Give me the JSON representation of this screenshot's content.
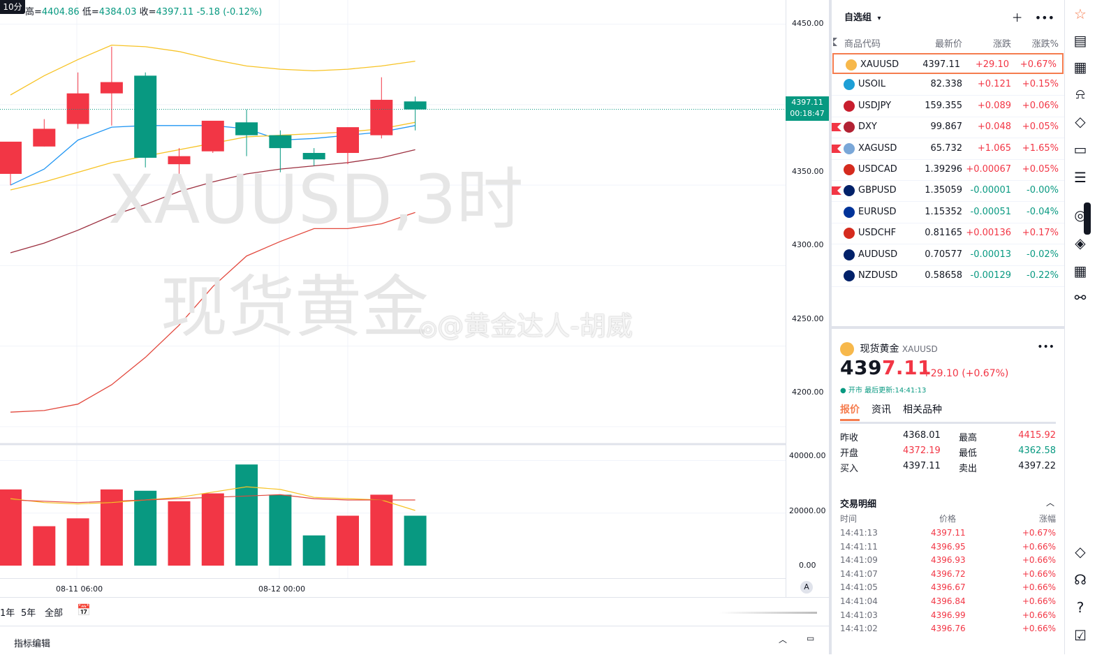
{
  "chart": {
    "interval": "10分",
    "ohlc": {
      "high_label": "高=",
      "high": "4404.86",
      "low_label": "低=",
      "low": "4384.03",
      "close_label": "收=",
      "close": "4397.11",
      "change": "-5.18",
      "change_pct": "(-0.12%)"
    },
    "watermark_symbol": "XAUUSD,3时",
    "watermark_name": "现货黄金",
    "weibo_watermark": "@黄金达人-胡威",
    "price_ticks": [
      "4450.00",
      "4400.00",
      "4350.00",
      "4300.00",
      "4250.00",
      "4200.00"
    ],
    "volume_ticks": [
      "40000.00",
      "20000.00",
      "0.00"
    ],
    "last_price": "4397.11",
    "countdown": "00:18:47",
    "time_ticks": [
      "08-11 06:00",
      "08-12 00:00"
    ],
    "range_buttons": [
      "1年",
      "5年",
      "全部"
    ],
    "auto_label": "A",
    "bottom_panel_label": "指标编辑",
    "colors": {
      "up": "#f23645",
      "down": "#089981",
      "ma_yellow": "#f7c325",
      "ma_blue": "#2196f3",
      "ma_brown": "#9c2f3f",
      "ma_red": "#e2483d"
    }
  },
  "chart_data": {
    "type": "candlestick",
    "candles": [
      {
        "open": 4357,
        "high": 4372,
        "low": 4350,
        "close": 4377
      },
      {
        "open": 4374,
        "high": 4391,
        "low": 4374,
        "close": 4385
      },
      {
        "open": 4388,
        "high": 4420,
        "low": 4385,
        "close": 4407
      },
      {
        "open": 4407,
        "high": 4436,
        "low": 4387,
        "close": 4414
      },
      {
        "open": 4418,
        "high": 4420,
        "low": 4361,
        "close": 4367
      },
      {
        "open": 4363,
        "high": 4373,
        "low": 4356,
        "close": 4368
      },
      {
        "open": 4371,
        "high": 4389,
        "low": 4370,
        "close": 4390
      },
      {
        "open": 4389,
        "high": 4397,
        "low": 4368,
        "close": 4381
      },
      {
        "open": 4381,
        "high": 4384,
        "low": 4358,
        "close": 4373
      },
      {
        "open": 4370,
        "high": 4373,
        "low": 4362,
        "close": 4366
      },
      {
        "open": 4370,
        "high": 4379,
        "low": 4363,
        "close": 4386
      },
      {
        "open": 4381,
        "high": 4417,
        "low": 4379,
        "close": 4403
      },
      {
        "open": 4402,
        "high": 4405,
        "low": 4384,
        "close": 4397
      }
    ],
    "volumes": [
      29000,
      15000,
      18000,
      29000,
      28500,
      24500,
      27500,
      38500,
      27000,
      11500,
      19000,
      27000,
      19000
    ],
    "ma_lines": [
      {
        "color": "#f7c325",
        "values": [
          4406,
          4418,
          4428,
          4437,
          4436,
          4433,
          4428,
          4424,
          4422,
          4421,
          4422,
          4424,
          4427
        ]
      },
      {
        "color": "#2196f3",
        "values": [
          4350,
          4360,
          4378,
          4386,
          4387,
          4387,
          4387,
          4385,
          4378,
          4379,
          4381,
          4383,
          4387
        ]
      },
      {
        "color": "#f7c325",
        "values": [
          4347,
          4352,
          4358,
          4364,
          4368,
          4372,
          4376,
          4380,
          4381,
          4382,
          4383,
          4385,
          4389
        ]
      },
      {
        "color": "#9c2f3f",
        "values": [
          4308,
          4314,
          4322,
          4331,
          4338,
          4346,
          4352,
          4357,
          4360,
          4362,
          4364,
          4367,
          4372
        ]
      },
      {
        "color": "#e2483d",
        "values": [
          4209,
          4210,
          4214,
          4226,
          4243,
          4263,
          4287,
          4306,
          4315,
          4323,
          4323,
          4326,
          4333
        ]
      }
    ],
    "vol_ma_lines": [
      {
        "color": "#f7c325",
        "values": [
          25500,
          24000,
          23500,
          24000,
          25000,
          26000,
          28000,
          30000,
          29000,
          26000,
          25500,
          25000,
          21000
        ]
      },
      {
        "color": "#e2483d",
        "values": [
          25000,
          24500,
          24000,
          24500,
          25000,
          25500,
          26000,
          26500,
          27000,
          25500,
          25000,
          25000,
          25000
        ]
      }
    ],
    "price_range": [
      4190,
      4465
    ],
    "volume_range": [
      0,
      42000
    ],
    "x_labels": [
      "08-11 06:00",
      "08-12 00:00"
    ]
  },
  "watchlist": {
    "title": "自选组",
    "columns": [
      "商品代码",
      "最新价",
      "涨跌",
      "涨跌%"
    ],
    "rows": [
      {
        "symbol": "XAUUSD",
        "last": "4397.11",
        "change": "+29.10",
        "pct": "+0.67%",
        "dir": "pos",
        "flag": "#f7b84b",
        "selected": true,
        "marked": false
      },
      {
        "symbol": "USOIL",
        "last": "82.338",
        "change": "+0.121",
        "pct": "+0.15%",
        "dir": "pos",
        "flag": "#1e9fd6",
        "selected": false,
        "marked": false
      },
      {
        "symbol": "USDJPY",
        "last": "159.355",
        "change": "+0.089",
        "pct": "+0.06%",
        "dir": "pos",
        "flag": "#c81e2e",
        "selected": false,
        "marked": false
      },
      {
        "symbol": "DXY",
        "last": "99.867",
        "change": "+0.048",
        "pct": "+0.05%",
        "dir": "pos",
        "flag": "#b22234",
        "selected": false,
        "marked": true
      },
      {
        "symbol": "XAGUSD",
        "last": "65.732",
        "change": "+1.065",
        "pct": "+1.65%",
        "dir": "pos",
        "flag": "#7aa7d8",
        "selected": false,
        "marked": true
      },
      {
        "symbol": "USDCAD",
        "last": "1.39296",
        "change": "+0.00067",
        "pct": "+0.05%",
        "dir": "pos",
        "flag": "#d52b1e",
        "selected": false,
        "marked": false
      },
      {
        "symbol": "GBPUSD",
        "last": "1.35059",
        "change": "-0.00001",
        "pct": "-0.00%",
        "dir": "neg",
        "flag": "#012169",
        "selected": false,
        "marked": true
      },
      {
        "symbol": "EURUSD",
        "last": "1.15352",
        "change": "-0.00051",
        "pct": "-0.04%",
        "dir": "neg",
        "flag": "#003399",
        "selected": false,
        "marked": false
      },
      {
        "symbol": "USDCHF",
        "last": "0.81165",
        "change": "+0.00136",
        "pct": "+0.17%",
        "dir": "pos",
        "flag": "#d52b1e",
        "selected": false,
        "marked": false
      },
      {
        "symbol": "AUDUSD",
        "last": "0.70577",
        "change": "-0.00013",
        "pct": "-0.02%",
        "dir": "neg",
        "flag": "#012169",
        "selected": false,
        "marked": false
      },
      {
        "symbol": "NZDUSD",
        "last": "0.58658",
        "change": "-0.00129",
        "pct": "-0.22%",
        "dir": "neg",
        "flag": "#012169",
        "selected": false,
        "marked": false
      }
    ]
  },
  "detail": {
    "name": "现货黄金",
    "symbol": "XAUUSD",
    "price_main": "439",
    "price_tail": "7.11",
    "change": "+29.10 (+0.67%)",
    "status": "● 开市 最后更新:14:41:13",
    "tabs": [
      "报价",
      "资讯",
      "相关品种"
    ],
    "stats": [
      {
        "label": "昨收",
        "value": "4368.01",
        "label2": "最高",
        "value2": "4415.92"
      },
      {
        "label": "开盘",
        "value": "4372.19",
        "label2": "最低",
        "value2": "4362.58"
      },
      {
        "label": "买入",
        "value": "4397.11",
        "label2": "卖出",
        "value2": "4397.22"
      }
    ],
    "trades_title": "交易明细",
    "trades_columns": [
      "时间",
      "价格",
      "涨幅"
    ],
    "trades": [
      {
        "time": "14:41:13",
        "price": "4397.11",
        "pct": "+0.67%"
      },
      {
        "time": "14:41:11",
        "price": "4396.95",
        "pct": "+0.66%"
      },
      {
        "time": "14:41:09",
        "price": "4396.93",
        "pct": "+0.66%"
      },
      {
        "time": "14:41:07",
        "price": "4396.72",
        "pct": "+0.66%"
      },
      {
        "time": "14:41:05",
        "price": "4396.67",
        "pct": "+0.66%"
      },
      {
        "time": "14:41:04",
        "price": "4396.84",
        "pct": "+0.66%"
      },
      {
        "time": "14:41:03",
        "price": "4396.99",
        "pct": "+0.66%"
      },
      {
        "time": "14:41:02",
        "price": "4396.76",
        "pct": "+0.66%"
      }
    ]
  }
}
